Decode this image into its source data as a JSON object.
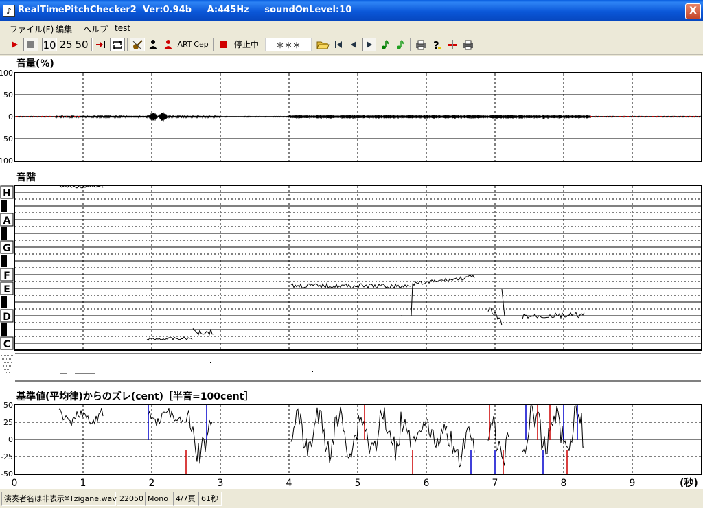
{
  "window": {
    "title": "RealTimePitchChecker2  Ver:0.94b     A:445Hz     soundOnLevel:10",
    "app_icon": "violin-icon",
    "close_label": "X"
  },
  "menu": [
    "ファイル(F)",
    "編集",
    "ヘルプ",
    "test"
  ],
  "toolbar": {
    "n10": "10",
    "n25": "25",
    "n50": "50",
    "art": "ART",
    "cep": "Cep",
    "status": "停止中",
    "note_display": "＊＊＊",
    "icons": [
      "play-icon",
      "stop-icon",
      "skip-to-end-icon",
      "loop-icon",
      "violin-icon",
      "player-black-icon",
      "player-red-icon",
      "record-stop-icon",
      "open-folder-icon",
      "first-icon",
      "previous-icon",
      "next-icon",
      "note-icon",
      "note-icon",
      "print-icon",
      "help-icon",
      "marker-icon",
      "printer-icon"
    ]
  },
  "panels": {
    "volume_title": "音量(%)",
    "volume_ticks": [
      "100",
      "50",
      "0",
      "50",
      "100"
    ],
    "scale_title": "音階",
    "note_labels": [
      "H",
      "A",
      "G",
      "F",
      "E",
      "D",
      "C"
    ],
    "cents_title": "基準値(平均律)からのズレ(cent)［半音=100cent］",
    "cents_ticks": [
      "50",
      "25",
      "0",
      "-25",
      "-50"
    ]
  },
  "time_axis": {
    "ticks": [
      "0",
      "1",
      "2",
      "3",
      "4",
      "5",
      "6",
      "7",
      "8",
      "9"
    ],
    "unit": "(秒)"
  },
  "statusbar": [
    "演奏者名は非表示¥Tzigane.wav",
    "22050",
    "Mono",
    "4/7頁",
    "61秒"
  ],
  "colors": {
    "title_bar": "#0A5FE0",
    "grid": "#000000",
    "trace": "#000000",
    "cents_red": "#CC0000",
    "cents_blue": "#0000CC"
  }
}
